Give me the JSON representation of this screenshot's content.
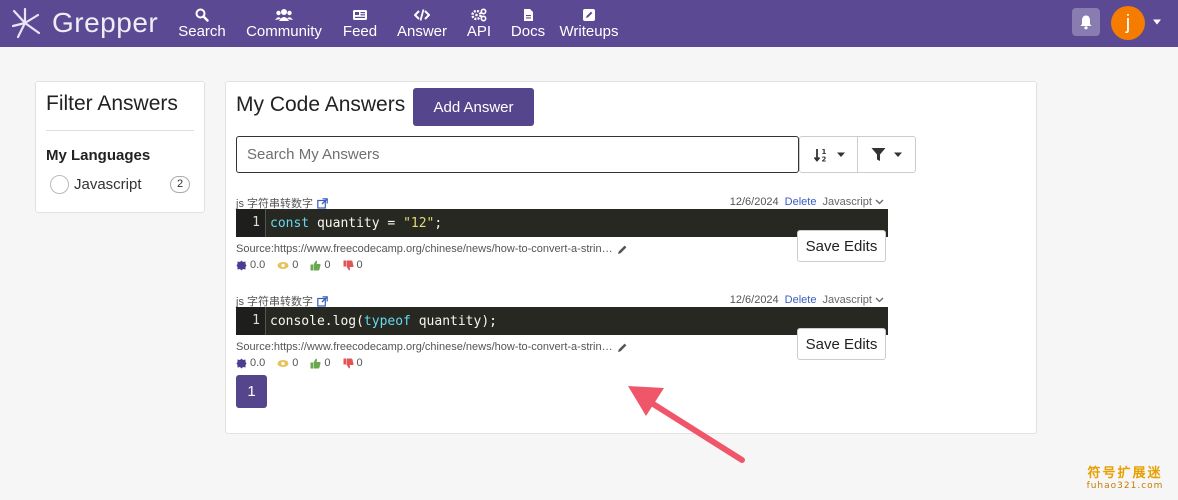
{
  "navbar": {
    "brand": "Grepper",
    "items": [
      {
        "label": "Search",
        "icon": "search-icon"
      },
      {
        "label": "Community",
        "icon": "users-icon"
      },
      {
        "label": "Feed",
        "icon": "newspaper-icon"
      },
      {
        "label": "Answer",
        "icon": "code-icon"
      },
      {
        "label": "API",
        "icon": "cogs-icon"
      },
      {
        "label": "Docs",
        "icon": "file-icon"
      },
      {
        "label": "Writeups",
        "icon": "edit-icon"
      }
    ],
    "avatar_letter": "j",
    "colors": {
      "bar": "#5b4a93",
      "avatar": "#f57c00"
    }
  },
  "filter": {
    "title": "Filter Answers",
    "languages_heading": "My Languages",
    "languages": [
      {
        "label": "Javascript",
        "count": "2"
      }
    ]
  },
  "main": {
    "title": "My Code Answers",
    "add_button": "Add Answer",
    "search_placeholder": "Search My Answers",
    "answers": [
      {
        "title": "js 字符串转数字",
        "date": "12/6/2024",
        "delete": "Delete",
        "language": "Javascript",
        "line_number": "1",
        "code_tokens": [
          {
            "t": "const",
            "c": "kw"
          },
          {
            "t": " quantity = ",
            "c": ""
          },
          {
            "t": "\"12\"",
            "c": "str"
          },
          {
            "t": ";",
            "c": ""
          }
        ],
        "source": "Source:https://www.freecodecamp.org/chinese/news/how-to-convert-a-strin…",
        "stats": {
          "rank": "0.0",
          "views": "0",
          "up": "0",
          "down": "0"
        },
        "save": "Save Edits"
      },
      {
        "title": "js 字符串转数字",
        "date": "12/6/2024",
        "delete": "Delete",
        "language": "Javascript",
        "line_number": "1",
        "code_tokens": [
          {
            "t": "console.log(",
            "c": ""
          },
          {
            "t": "typeof",
            "c": "kw"
          },
          {
            "t": " quantity);",
            "c": ""
          }
        ],
        "source": "Source:https://www.freecodecamp.org/chinese/news/how-to-convert-a-strin…",
        "stats": {
          "rank": "0.0",
          "views": "0",
          "up": "0",
          "down": "0"
        },
        "save": "Save Edits"
      }
    ],
    "pagination": {
      "current": "1"
    },
    "accent": "#54458c"
  },
  "watermark": {
    "line1": "符号扩展迷",
    "line2": "fuhao321.com"
  }
}
